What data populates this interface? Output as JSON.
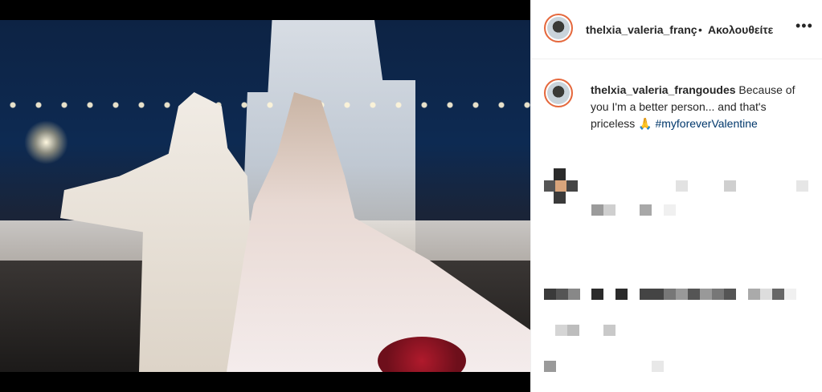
{
  "post": {
    "username": "thelxia_valeria_frangoudes",
    "header_username": "thelxia_valeria_franç",
    "separator": "•",
    "follow_status": "Ακολουθείτε",
    "more_label": "•••",
    "caption_text": " Because of you I'm a better person... and that's priceless 🙏 ",
    "hashtag": "#myforeverValentine"
  },
  "colors": {
    "accent_link": "#00376b",
    "story_ring": "#e6683c",
    "divider": "#efefef"
  }
}
